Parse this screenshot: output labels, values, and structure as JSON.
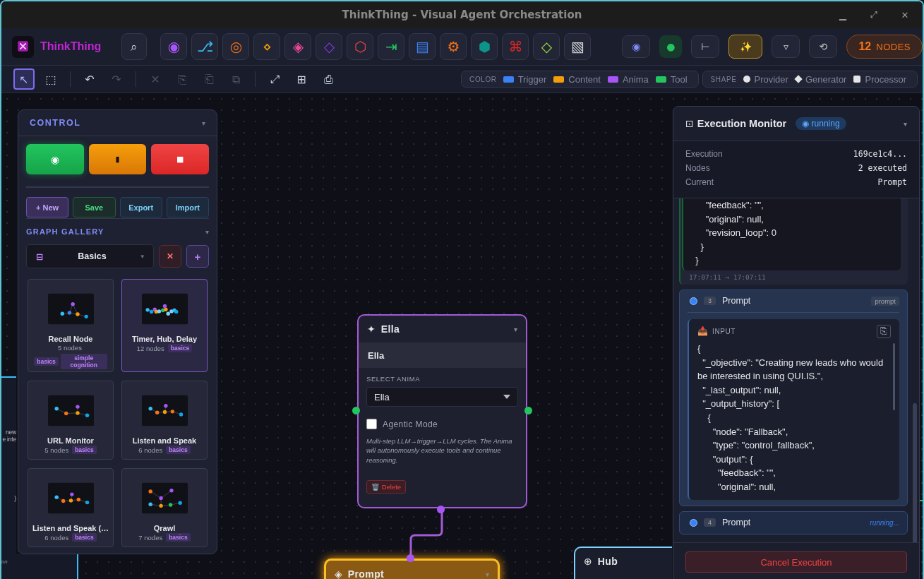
{
  "window": {
    "title": "ThinkThing - Visual Agent Orchestration",
    "controls": [
      "▁",
      "⤢",
      "✕"
    ]
  },
  "brand": {
    "name": "ThinkThing"
  },
  "toolbar": {
    "search": "⌕",
    "palette": [
      {
        "glyph": "◉",
        "color": "#a855f7"
      },
      {
        "glyph": "⎇",
        "color": "#38bdf8"
      },
      {
        "glyph": "◎",
        "color": "#f97316"
      },
      {
        "glyph": "⋄",
        "color": "#f59e0b"
      },
      {
        "glyph": "◈",
        "color": "#ec4899"
      },
      {
        "glyph": "◇",
        "color": "#7c3aed"
      },
      {
        "glyph": "⬡",
        "color": "#ef4444"
      },
      {
        "glyph": "⇥",
        "color": "#22c55e"
      },
      {
        "glyph": "▤",
        "color": "#3b82f6"
      },
      {
        "glyph": "⚙",
        "color": "#f97316"
      },
      {
        "glyph": "⬢",
        "color": "#0d9488"
      },
      {
        "glyph": "⌘",
        "color": "#dc2626"
      },
      {
        "glyph": "◇",
        "color": "#a3e635"
      },
      {
        "glyph": "▧",
        "color": "#d4d4d8"
      }
    ],
    "actions": [
      {
        "glyph": "◉",
        "kind": "plain"
      },
      {
        "glyph": "●",
        "kind": "status"
      },
      {
        "glyph": "⊢",
        "kind": "plain"
      },
      {
        "glyph": "✨",
        "kind": "magic"
      },
      {
        "glyph": "▿",
        "kind": "plain"
      },
      {
        "glyph": "⟲",
        "kind": "plain"
      }
    ],
    "node_count": {
      "value": "12",
      "label": "NODES"
    }
  },
  "tool_groups": [
    [
      {
        "glyph": "↖",
        "selected": true,
        "disabled": false
      },
      {
        "glyph": "⬚",
        "selected": false,
        "disabled": false
      }
    ],
    [
      {
        "glyph": "↶",
        "selected": false,
        "disabled": false
      },
      {
        "glyph": "↷",
        "selected": false,
        "disabled": true
      }
    ],
    [
      {
        "glyph": "✕",
        "selected": false,
        "disabled": true
      },
      {
        "glyph": "⎘",
        "selected": false,
        "disabled": true
      },
      {
        "glyph": "⎗",
        "selected": false,
        "disabled": true
      },
      {
        "glyph": "⧉",
        "selected": false,
        "disabled": true
      }
    ],
    [
      {
        "glyph": "⤢",
        "selected": false,
        "disabled": false
      },
      {
        "glyph": "⊞",
        "selected": false,
        "disabled": false
      },
      {
        "glyph": "⎙",
        "selected": false,
        "disabled": false
      }
    ]
  ],
  "legend": {
    "color": {
      "title": "COLOR",
      "items": [
        {
          "label": "Trigger",
          "color": "#3b82f6"
        },
        {
          "label": "Content",
          "color": "#f59e0b"
        },
        {
          "label": "Anima",
          "color": "#a855f7"
        },
        {
          "label": "Tool",
          "color": "#22c55e"
        }
      ]
    },
    "shape": {
      "title": "SHAPE",
      "items": [
        {
          "label": "Provider",
          "kind": "circle"
        },
        {
          "label": "Generator",
          "kind": "diamond"
        },
        {
          "label": "Processor",
          "kind": "square"
        }
      ]
    }
  },
  "background_node": {
    "lines": [
      "new",
      "e inte",
      ")",
      "on"
    ]
  },
  "control": {
    "title": "CONTROL",
    "collapse": "▾",
    "run_buttons": [
      {
        "glyph": "◉",
        "kind": "run"
      },
      {
        "glyph": "▮",
        "kind": "pause"
      },
      {
        "glyph": "■",
        "kind": "stop"
      }
    ],
    "file_buttons": [
      {
        "label": "+ New",
        "kind": "new"
      },
      {
        "label": "Save",
        "kind": "save"
      },
      {
        "label": "Export",
        "kind": "export"
      },
      {
        "label": "Import",
        "kind": "import"
      }
    ],
    "gallery": {
      "title": "GRAPH GALLERY",
      "collapse": "▾",
      "select_icon": "⊟",
      "category": "Basics",
      "caret": "▾",
      "delete": "✕",
      "add": "+",
      "cards": [
        {
          "name": "Recall Node",
          "count": "5 nodes",
          "tags": [
            "basics",
            "simple cognition"
          ],
          "selected": false
        },
        {
          "name": "Timer, Hub, Delay",
          "count": "12 nodes",
          "tags": [
            "basics"
          ],
          "selected": true
        },
        {
          "name": "URL Monitor",
          "count": "5 nodes",
          "tags": [
            "basics"
          ],
          "selected": false
        },
        {
          "name": "Listen and Speak",
          "count": "6 nodes",
          "tags": [
            "basics"
          ],
          "selected": false
        },
        {
          "name": "Listen and Speak (…",
          "count": "6 nodes",
          "tags": [
            "basics"
          ],
          "selected": false
        },
        {
          "name": "Qrawl",
          "count": "7 nodes",
          "tags": [
            "basics"
          ],
          "selected": false
        }
      ]
    }
  },
  "nodes": [
    {
      "kind": "anima",
      "icon": "✦",
      "title": "Ella",
      "collapse": "▾",
      "subtitle": "Ella",
      "field_label": "SELECT ANIMA",
      "field_value": "Ella",
      "checkbox": {
        "label": "Agentic Mode",
        "checked": false
      },
      "description": "Multi-step LLM→trigger→LLM cycles. The Anima will autonomously execute tools and continue reasoning.",
      "delete": "🗑️ Delete"
    },
    {
      "kind": "prompt",
      "icon": "◈",
      "title": "Prompt",
      "collapse": "▾"
    },
    {
      "kind": "hub",
      "icon": "⊕",
      "title": "Hub"
    }
  ],
  "monitor": {
    "icon": "⊡",
    "title": "Execution Monitor",
    "status": "◉ running",
    "collapse": "▾",
    "stats": [
      {
        "label": "Execution",
        "value": "169ce1c4..."
      },
      {
        "label": "Nodes",
        "value": "2 executed"
      },
      {
        "label": "Current",
        "value": "Prompt"
      }
    ],
    "previous_output": [
      "      \"feedback\": \"\",",
      "      \"original\": null,",
      "      \"revision_loop\": 0",
      "    }",
      "  }"
    ],
    "previous_time": "17:07:11 → 17:07:11",
    "steps": [
      {
        "number": "3",
        "name": "Prompt",
        "tag": "prompt",
        "expanded": true,
        "input_label": "INPUT",
        "input_icon": "📥",
        "copy": "⎘",
        "input": [
          "{",
          "  \"_objective\": \"Creating new leads who would be interested in using QUI.IS.\",",
          "  \"_last_output\": null,",
          "  \"_output_history\": [",
          "    {",
          "      \"node\": \"Fallback\",",
          "      \"type\": \"control_fallback\",",
          "      \"output\": {",
          "        \"feedback\": \"\",",
          "        \"original\": null,"
        ]
      },
      {
        "number": "4",
        "name": "Prompt",
        "status": "running...",
        "expanded": false
      }
    ],
    "cancel": "Cancel Execution"
  }
}
